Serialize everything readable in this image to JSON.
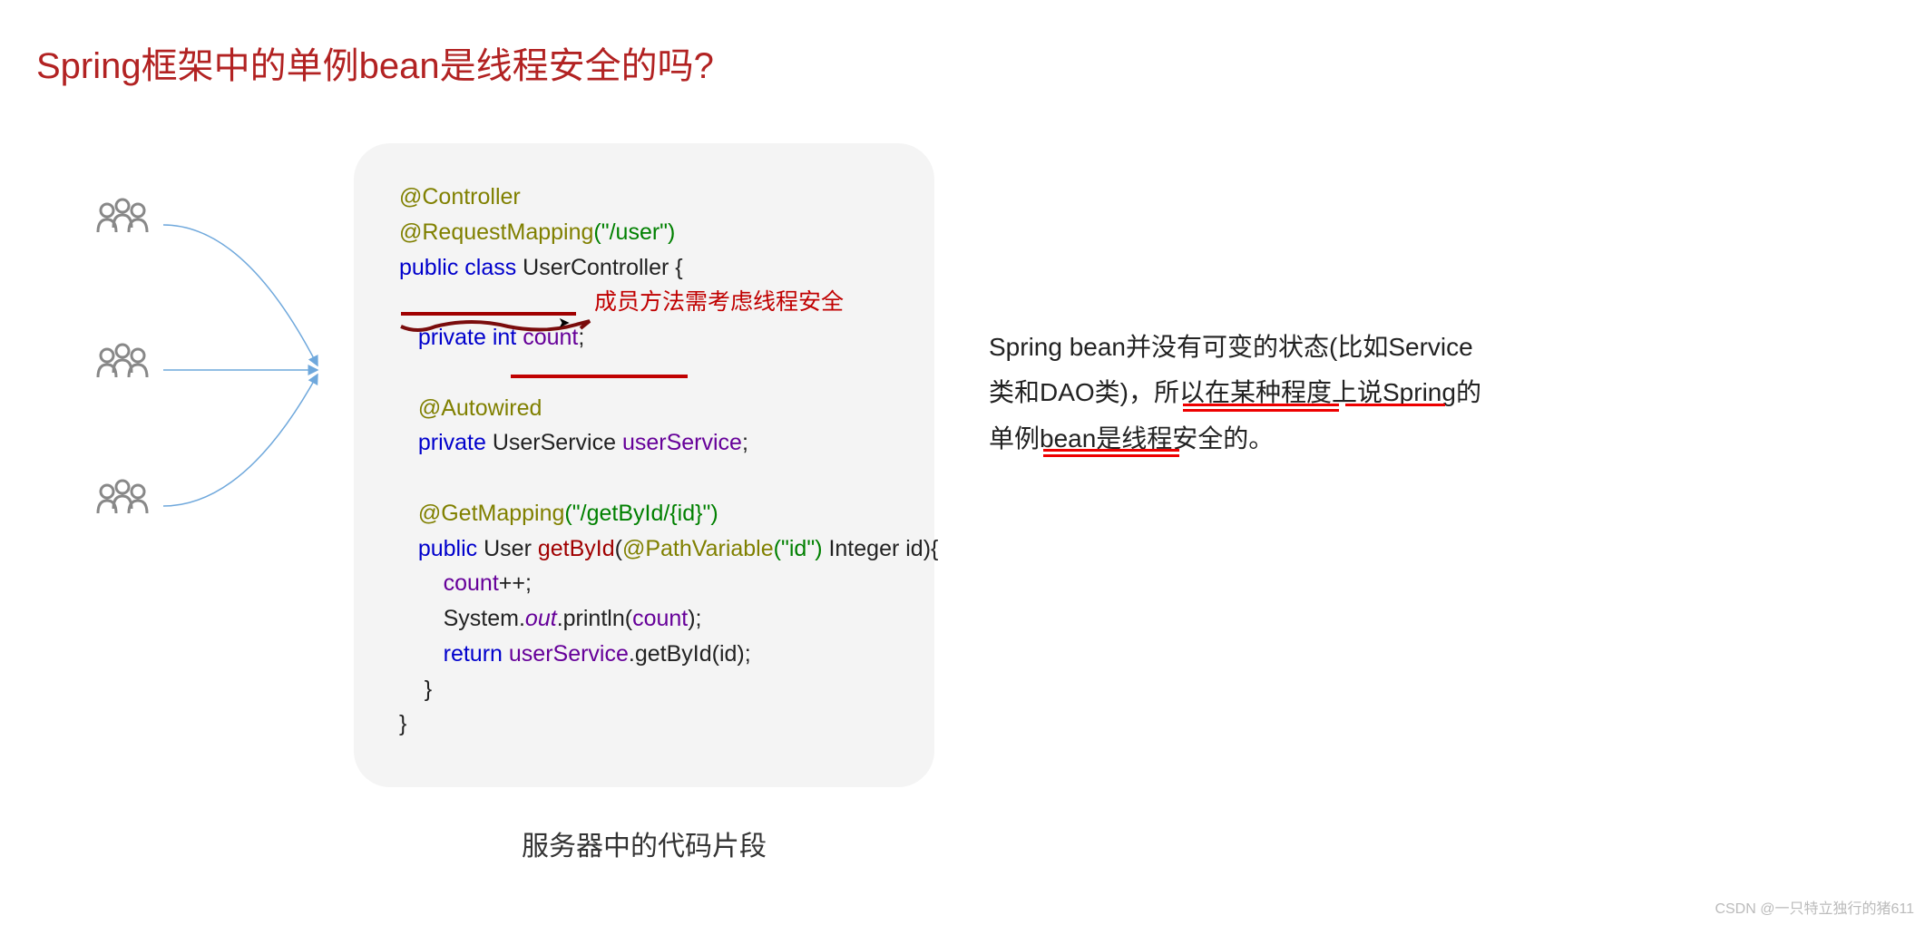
{
  "title": "Spring框架中的单例bean是线程安全的吗?",
  "code": {
    "controller": "@Controller",
    "requestMapping": "@RequestMapping",
    "reqPath": "(\"/user\")",
    "publicClass": "public class",
    "className": " UserController {",
    "private": "private",
    "int_kw": " int",
    "count_field": " count",
    "semi": ";",
    "note1": "成员方法需考虑线程安全",
    "autowired": "@Autowired",
    "userServiceType": " UserService ",
    "userServiceField": "userService",
    "getMapping": "@GetMapping",
    "getPath": "(\"/getById/{id}\")",
    "public_kw": "public",
    "userType": " User ",
    "methodName": "getById",
    "pathVar": "@PathVariable",
    "pathVarArg": "(\"id\")",
    "integerId": " Integer id){",
    "countInc_var": "count",
    "countInc_rest": "++;",
    "sout_sys": "System.",
    "sout_out": "out",
    "sout_rest": ".println(",
    "sout_count": "count",
    "sout_close": ");",
    "return_kw": "return",
    "us_var": " userService",
    "getById_call": ".getById(id);",
    "close1": "    }",
    "close2": "}"
  },
  "caption": "服务器中的代码片段",
  "paragraph": "Spring bean并没有可变的状态(比如Service类和DAO类)，所以在某种程度上说Spring的单例bean是线程安全的。",
  "watermark": "CSDN @一只特立独行的猪611",
  "users_glyph": "👥"
}
